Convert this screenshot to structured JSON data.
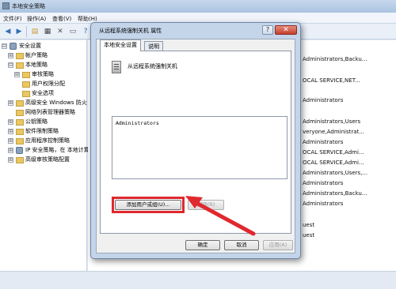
{
  "mmc": {
    "title": "本地安全策略",
    "menu": [
      "文件(F)",
      "操作(A)",
      "查看(V)",
      "帮助(H)"
    ],
    "tree": [
      {
        "label": "安全设置",
        "expander": "⊟",
        "level": 0
      },
      {
        "label": "帐户策略",
        "expander": "⊞",
        "level": 1
      },
      {
        "label": "本地策略",
        "expander": "⊟",
        "level": 1
      },
      {
        "label": "审核策略",
        "expander": "⊞",
        "level": 2
      },
      {
        "label": "用户权限分配",
        "expander": "",
        "level": 2
      },
      {
        "label": "安全选项",
        "expander": "",
        "level": 2
      },
      {
        "label": "高级安全 Windows 防火",
        "expander": "⊞",
        "level": 1
      },
      {
        "label": "网络列表管理器策略",
        "expander": "",
        "level": 1
      },
      {
        "label": "公钥策略",
        "expander": "⊞",
        "level": 1
      },
      {
        "label": "软件限制策略",
        "expander": "⊞",
        "level": 1
      },
      {
        "label": "应用程序控制策略",
        "expander": "⊞",
        "level": 1
      },
      {
        "label": "IP 安全策略，在 本地计算",
        "expander": "⊞",
        "level": 1
      },
      {
        "label": "高级审核策略配置",
        "expander": "⊞",
        "level": 1
      }
    ],
    "right_values": [
      "Administrators,Backu...",
      "OCAL SERVICE,NET...",
      "Administrators",
      "Administrators,Users",
      "veryone,Administrat...",
      "Administrators",
      "OCAL SERVICE,Admi...",
      "OCAL SERVICE,Admi...",
      "Administrators,Users,...",
      "Administrators",
      "Administrators,Backu...",
      "Administrators",
      "uest",
      "uest"
    ]
  },
  "dialog": {
    "title": "从远程系统强制关机 属性",
    "help": "?",
    "close": "✕",
    "tabs": [
      "本地安全设置",
      "说明"
    ],
    "policy_name": "从远程系统强制关机",
    "members": [
      "Administrators"
    ],
    "add_button": "添加用户或组(U)...",
    "remove_button": "删除(R)",
    "ok_button": "确定",
    "cancel_button": "取消",
    "apply_button": "应用(A)"
  },
  "colors": {
    "highlight": "#e0282f",
    "arrow": "#e0282f"
  }
}
